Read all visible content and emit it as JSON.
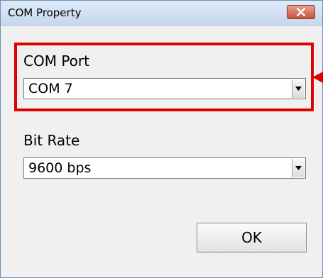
{
  "window": {
    "title": "COM Property",
    "close_icon": "close-x-icon"
  },
  "com_port": {
    "label": "COM Port",
    "value": "COM 7",
    "dropdown_icon": "chevron-down-icon"
  },
  "bit_rate": {
    "label": "Bit Rate",
    "value": "9600 bps",
    "dropdown_icon": "chevron-down-icon"
  },
  "ok_button": {
    "label": "OK"
  },
  "colors": {
    "highlight": "#e00000",
    "title_bar": "#d6e4f4",
    "close_button": "#c7513a"
  }
}
